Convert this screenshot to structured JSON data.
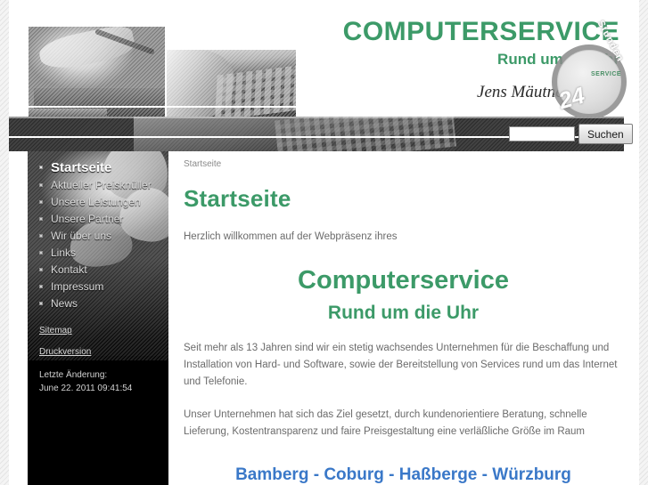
{
  "header": {
    "brand_main": "COMPUTERSERVICE",
    "brand_sub": "Rund um die Uhr",
    "owner_name": "Jens Mäutner",
    "seal_number": "24",
    "seal_word": "Stunden",
    "seal_caption": "SERVICE",
    "green": "#3c9a68"
  },
  "search": {
    "value": "",
    "placeholder": "",
    "button_label": "Suchen"
  },
  "sidebar": {
    "items": [
      {
        "label": "Startseite",
        "active": true
      },
      {
        "label": "Aktueller Preisknüller",
        "active": false
      },
      {
        "label": "Unsere Leistungen",
        "active": false
      },
      {
        "label": "Unsere Partner",
        "active": false
      },
      {
        "label": "Wir über uns",
        "active": false
      },
      {
        "label": "Links",
        "active": false
      },
      {
        "label": "Kontakt",
        "active": false
      },
      {
        "label": "Impressum",
        "active": false
      },
      {
        "label": "News",
        "active": false
      }
    ],
    "links": [
      {
        "label": "Sitemap"
      },
      {
        "label": "Druckversion"
      }
    ],
    "meta": {
      "changed_label": "Letzte Änderung:",
      "changed_value": "June 22. 2011 09:41:54"
    }
  },
  "main": {
    "breadcrumb": "Startseite",
    "page_title": "Startseite",
    "intro": "Herzlich willkommen auf der Webpräsenz ihres",
    "big_title": "Computerservice",
    "big_subtitle": "Rund um die Uhr",
    "paragraph_1": "Seit mehr als 13 Jahren sind wir ein stetig wachsendes Unternehmen für die Beschaffung und Installation von Hard- und Software, sowie der Bereitstellung von Services rund um das Internet und Telefonie.",
    "paragraph_2": "Unser Unternehmen hat sich das Ziel gesetzt, durch kundenorientiere Beratung, schnelle Lieferung, Kostentransparenz und faire Preisgestaltung eine verläßliche Größe im Raum",
    "regions": "Bamberg - Coburg - Haßberge - Würzburg",
    "accent_green": "#3c9a68",
    "accent_blue": "#3a78c8"
  }
}
